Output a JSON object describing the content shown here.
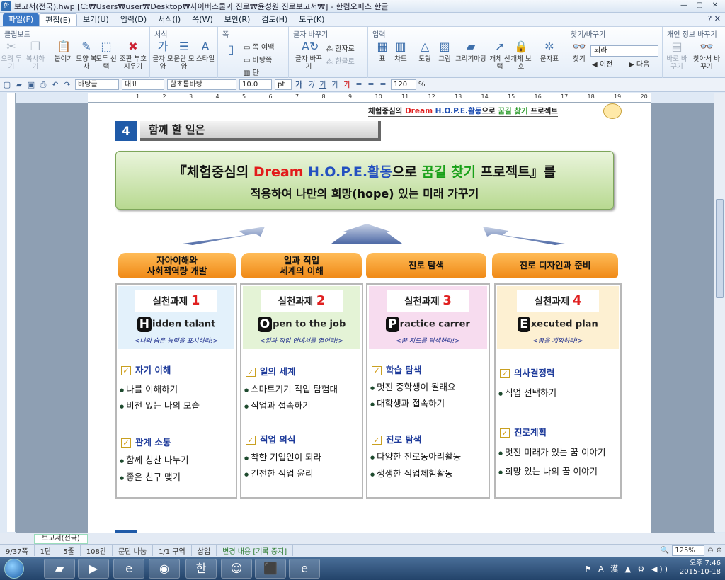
{
  "window": {
    "title": "보고서(전국).hwp [C:₩Users₩user₩Desktop₩사이버스쿨과 진로₩윤성원 진로보고서₩] - 한컴오피스 한글",
    "controls": [
      "—",
      "▢",
      "✕"
    ]
  },
  "menu": {
    "items": [
      "파일(F)",
      "편집(E)",
      "보기(U)",
      "입력(D)",
      "서식(J)",
      "쪽(W)",
      "보안(R)",
      "검토(H)",
      "도구(K)"
    ],
    "help": "? ✕"
  },
  "ribbon": {
    "groups": [
      "클립보드",
      "서식",
      "쪽",
      "글자 바꾸기",
      "입력",
      "찾기/바꾸기",
      "개인 정보 바꾸기"
    ],
    "clipboard": [
      "오려 두기",
      "복사하기",
      "붙이기",
      "모양 복사",
      "모두 선택",
      "조판 부호 지우기"
    ],
    "format": [
      "글자 모양",
      "문단 모양",
      "스타일"
    ],
    "page": [
      "쪽 여백",
      "바탕쪽",
      "단"
    ],
    "charchange": [
      "글자 바꾸기",
      "한자로",
      "한글로"
    ],
    "insert": [
      "표",
      "차트",
      "도형",
      "그림",
      "그리기마당",
      "개체 선택",
      "개체 보호",
      "문자표"
    ],
    "find": {
      "button": "찾기",
      "value": "되라",
      "prev": "이전",
      "next": "다음"
    },
    "privacy": [
      "바로 바꾸기",
      "찾아서 바꾸기"
    ]
  },
  "toolbar": {
    "style": "바탕글",
    "lang": "대표",
    "font": "함초롬바탕",
    "size": "10.0",
    "unit": "pt",
    "zoom": "120",
    "zoom_unit": "%"
  },
  "ruler": [
    "1",
    "2",
    "3",
    "4",
    "5",
    "6",
    "7",
    "8",
    "9",
    "10",
    "11",
    "12",
    "13",
    "14",
    "15",
    "16",
    "17",
    "18",
    "19",
    "20"
  ],
  "doc": {
    "header": {
      "pre": "체험중심의 ",
      "dream": "Dream ",
      "hope": "H.O.P.E.활동",
      "post1": "으로 ",
      "goal": "꿈길 찾기",
      "post2": " 프로젝트"
    },
    "section_num": "4",
    "section_title": "함께 할 일은",
    "banner": {
      "open": "『체험중심의 ",
      "dream": "Dream ",
      "hope": "H.O.P.E.활동",
      "mid": "으로 ",
      "goal": "꿈길 찾기",
      "close": " 프로젝트』를",
      "line2": "적용하여 나만의 희망(hope) 있는 미래 가꾸기"
    },
    "categories": [
      "자아이해와\n사회적역량 개발",
      "일과 직업\n세계의 이해",
      "진로 탐색",
      "진로 디자인과 준비"
    ],
    "cards": [
      {
        "task": "실천과제 ",
        "num": "1",
        "letter": "H",
        "rest": "idden talant",
        "motto": "<나의 숨은 능력을 표시하라!>",
        "bg": "#e3f1fb",
        "sub1": "자기 이해",
        "items1": [
          "나를 이해하기",
          "비전 있는 나의 모습"
        ],
        "sub2": "관계 소통",
        "items2": [
          "함께 칭찬 나누기",
          "좋은 친구 맺기"
        ]
      },
      {
        "task": "실천과제 ",
        "num": "2",
        "letter": "O",
        "rest": "pen to the job",
        "motto": "<일과 직업 안내서를 열어라!>",
        "bg": "#e4f3d6",
        "sub1": "일의 세계",
        "items1": [
          "스마트기기 직업 탐험대",
          "직업과 접속하기"
        ],
        "sub2": "직업 의식",
        "items2": [
          "착한 기업인이 되라",
          "건전한 직업 윤리"
        ]
      },
      {
        "task": "실천과제 ",
        "num": "3",
        "letter": "P",
        "rest": "ractice carrer",
        "motto": "<꿈 지도를 탐색하라!>",
        "bg": "#f7dcef",
        "sub1": "학습 탐색",
        "items1": [
          "멋진 중학생이 될래요",
          "대학생과 접속하기"
        ],
        "sub2": "진로 탐색",
        "items2": [
          "다양한 진로동아리활동",
          "생생한 직업체험활동"
        ]
      },
      {
        "task": "실천과제 ",
        "num": "4",
        "letter": "E",
        "rest": "xecuted plan",
        "motto": "<꿈을 계획하라!>",
        "bg": "#fdf0d2",
        "sub1": "의사결정력",
        "items1": [
          "직업 선택하기"
        ],
        "sub2": "진로계획",
        "items2": [
          "멋진 미래가 있는 꿈 이야기",
          "희망 있는 나의 꿈 이야기"
        ]
      }
    ]
  },
  "doc_tab": "보고서(전국)",
  "status": {
    "page": "9/37쪽",
    "col": "1단",
    "line": "5줄",
    "char": "108칸",
    "break": "문단 나눔",
    "area": "1/1 구역",
    "mode": "삽입",
    "track": "변경 내용 [기록 중지]",
    "zoom": "125%"
  },
  "taskbar": {
    "time": "오후 7:46",
    "date": "2015-10-18",
    "lang": "A 漢"
  },
  "colors": {
    "accent": "#1f5aa8",
    "red": "#e21b1b",
    "green": "#18a018",
    "orange": "#f08a17"
  }
}
